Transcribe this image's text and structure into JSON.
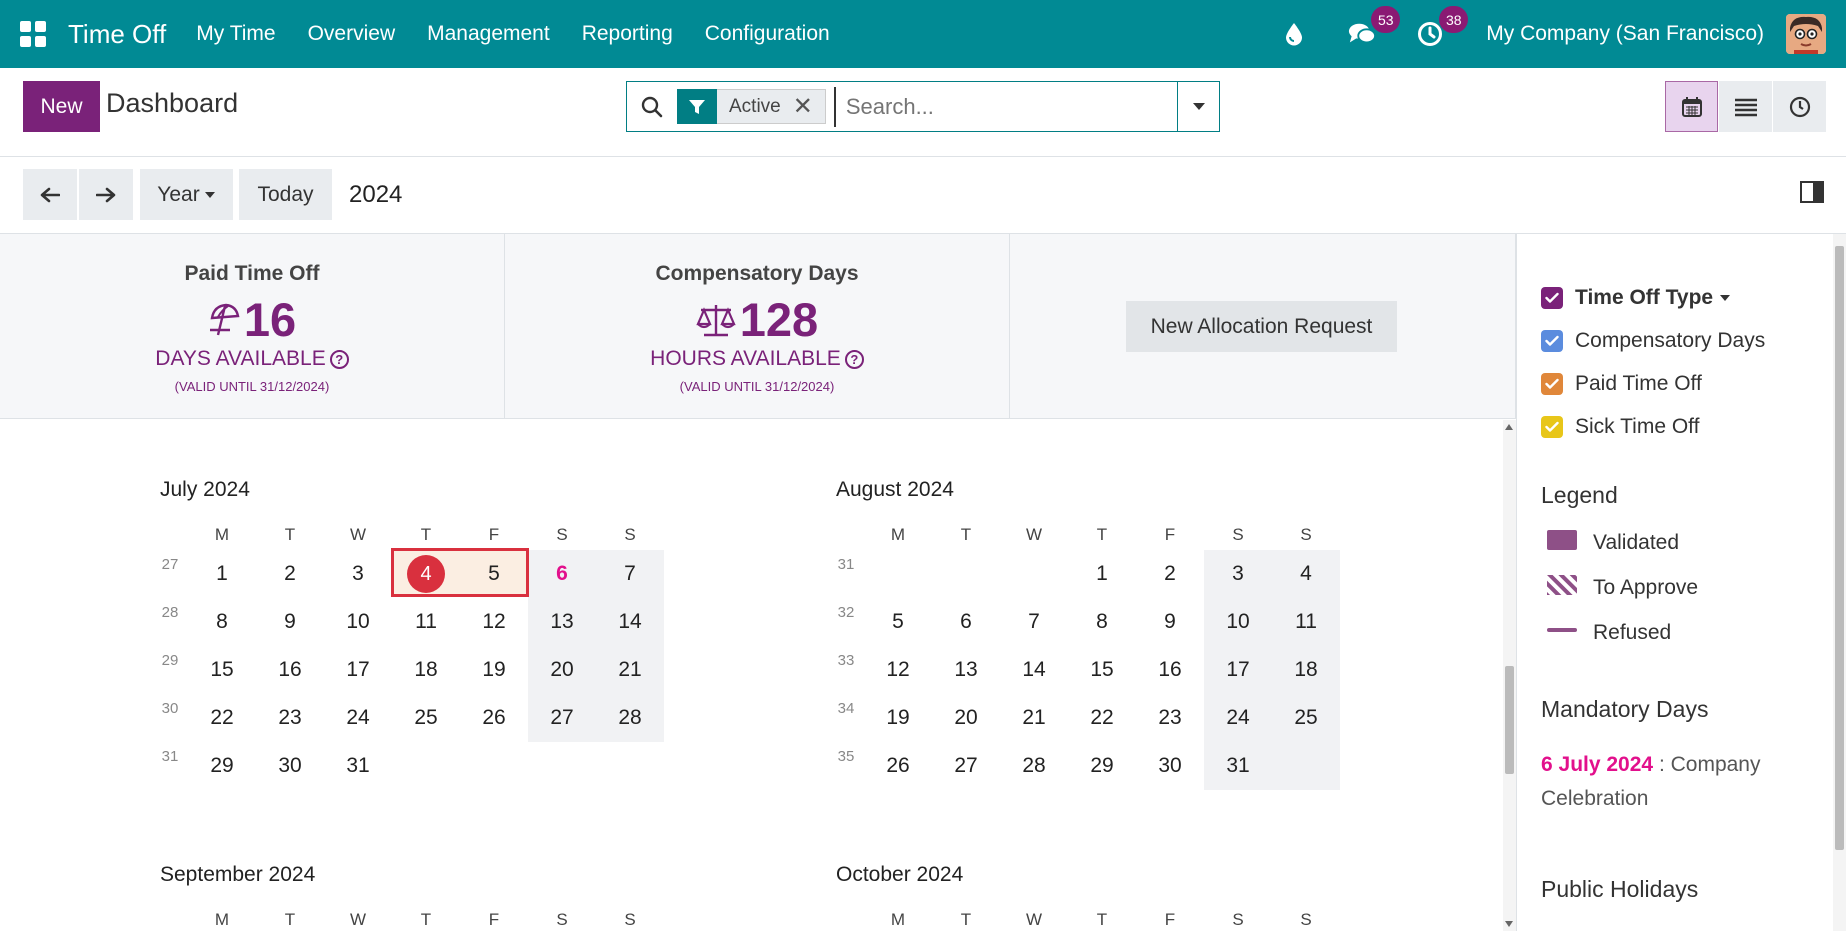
{
  "navbar": {
    "brand": "Time Off",
    "menu": [
      "My Time",
      "Overview",
      "Management",
      "Reporting",
      "Configuration"
    ],
    "messages_badge": "53",
    "activities_badge": "38",
    "company": "My Company (San Francisco)"
  },
  "control": {
    "new_label": "New",
    "title": "Dashboard",
    "facet_label": "Active",
    "search_placeholder": "Search..."
  },
  "toolbar": {
    "scale_label": "Year",
    "today_label": "Today",
    "current_period": "2024"
  },
  "stats": [
    {
      "title": "Paid Time Off",
      "value": "16",
      "unit": "DAYS AVAILABLE",
      "note": "(VALID UNTIL 31/12/2024)",
      "icon": "umbrella-beach-icon"
    },
    {
      "title": "Compensatory Days",
      "value": "128",
      "unit": "HOURS AVAILABLE",
      "note": "(VALID UNTIL 31/12/2024)",
      "icon": "balance-scale-icon"
    }
  ],
  "new_allocation_label": "New Allocation Request",
  "weekday_headers": [
    "M",
    "T",
    "W",
    "T",
    "F",
    "S",
    "S"
  ],
  "months": [
    {
      "title": "July 2024",
      "weeks": [
        {
          "week": "27",
          "days": [
            "1",
            "2",
            "3",
            "4",
            "5",
            "6",
            "7"
          ]
        },
        {
          "week": "28",
          "days": [
            "8",
            "9",
            "10",
            "11",
            "12",
            "13",
            "14"
          ]
        },
        {
          "week": "29",
          "days": [
            "15",
            "16",
            "17",
            "18",
            "19",
            "20",
            "21"
          ]
        },
        {
          "week": "30",
          "days": [
            "22",
            "23",
            "24",
            "25",
            "26",
            "27",
            "28"
          ]
        },
        {
          "week": "31",
          "days": [
            "29",
            "30",
            "31",
            "",
            "",
            "",
            ""
          ]
        }
      ]
    },
    {
      "title": "August 2024",
      "weeks": [
        {
          "week": "31",
          "days": [
            "",
            "",
            "",
            "1",
            "2",
            "3",
            "4"
          ]
        },
        {
          "week": "32",
          "days": [
            "5",
            "6",
            "7",
            "8",
            "9",
            "10",
            "11"
          ]
        },
        {
          "week": "33",
          "days": [
            "12",
            "13",
            "14",
            "15",
            "16",
            "17",
            "18"
          ]
        },
        {
          "week": "34",
          "days": [
            "19",
            "20",
            "21",
            "22",
            "23",
            "24",
            "25"
          ]
        },
        {
          "week": "35",
          "days": [
            "26",
            "27",
            "28",
            "29",
            "30",
            "31",
            ""
          ]
        }
      ]
    },
    {
      "title": "September 2024",
      "weeks": []
    },
    {
      "title": "October 2024",
      "weeks": []
    }
  ],
  "today_day": "4",
  "selected_range": [
    "4",
    "5"
  ],
  "mandatory_highlight_day": "6",
  "sidebar": {
    "filter_title": "Time Off Type",
    "filters": [
      {
        "label": "Compensatory Days",
        "color": "#5b8cde"
      },
      {
        "label": "Paid Time Off",
        "color": "#e0873a"
      },
      {
        "label": "Sick Time Off",
        "color": "#e8c619"
      }
    ],
    "title_checkbox_color": "#7a2279",
    "legend_title": "Legend",
    "legend": [
      {
        "label": "Validated",
        "style": "solid"
      },
      {
        "label": "To Approve",
        "style": "hatched"
      },
      {
        "label": "Refused",
        "style": "line"
      }
    ],
    "legend_color": "#8e5087",
    "mandatory_title": "Mandatory Days",
    "mandatory_date": "6 July 2024",
    "mandatory_text": ": Company Celebration",
    "public_holidays_title": "Public Holidays"
  },
  "colors": {
    "navbar": "#018a94",
    "primary": "#7a2279",
    "today": "#d9303e",
    "mandatory": "#e2108c"
  }
}
